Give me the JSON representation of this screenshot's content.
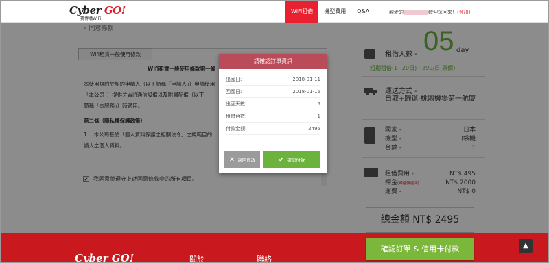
{
  "header": {
    "logo_main": "Cyber ",
    "logo_go": "GO!",
    "logo_sub": "賽博購WiFi",
    "nav": [
      "WiFi租借",
      "機型費用",
      "Q&A"
    ],
    "welcome_prefix": "親愛的",
    "welcome_suffix": "歡迎您回來！",
    "logout": "(登出)"
  },
  "terms": {
    "section_title": "» 同意條款",
    "tab_label": "Wifi租賃一般使用條款",
    "heading": "Wifi租賃一般使用條款第一條（適用範圍）",
    "para1": "本使用規約於契約申請人（以下簡稱「申請人」）申請使用",
    "para1b": "「本公司」）提供之Wifi通信設備以及附屬配備（以下",
    "para1c": "簡稱「本服務」）時適用。",
    "heading2": "第二條（隱私權保護政策）",
    "para2": "1.　本公司基於「個人資料保護之相關法令」之規範目的",
    "para2b": "請人之個人資料。",
    "agree_label": "我同意並遵守上述同意條款中的所有項目。"
  },
  "summary": {
    "rental_days_label": "租借天數 -",
    "rental_days_value": "05",
    "rental_days_unit": "day",
    "plan_text": "短期租借(1~20日) - 399/日(票價)",
    "shipping_label": "運送方式 -",
    "shipping_value": "自取+歸還-桃園機場第一航廈",
    "country_label": "國家 -",
    "country_value": "日本",
    "model_label": "機型 -",
    "model_value": "口袋機",
    "units_label": "台數 -",
    "units_value": "1",
    "rent_fee_label": "租借費用 -",
    "rent_fee_value": "NT$ 495",
    "deposit_label": "押金",
    "deposit_note": "(歸還後退回)",
    "deposit_value": "NT$ 2000",
    "shipping_fee_label": "運費 -",
    "shipping_fee_value": "NT$ 0",
    "total_label": "總金額 NT$ 2495"
  },
  "modal": {
    "title": "請確認訂單資訊",
    "rows": [
      {
        "label": "出國日:",
        "value": "2018-01-11"
      },
      {
        "label": "回國日:",
        "value": "2018-01-15"
      },
      {
        "label": "出國天數:",
        "value": "5"
      },
      {
        "label": "租借台數:",
        "value": "1"
      },
      {
        "label": "付款金額:",
        "value": "2495"
      }
    ],
    "back_label": "返回修改",
    "ok_label": "確認付款"
  },
  "footer": {
    "logo": "Cyber GO!",
    "nav1": "關於",
    "nav2": "聯絡",
    "confirm_pay": "確認訂單 & 信用卡付款",
    "to_top_icon": "chevron-up-icon"
  },
  "colors": {
    "brand_red": "#e8202f",
    "green": "#6cb33e",
    "modal_header": "#b94c58"
  }
}
